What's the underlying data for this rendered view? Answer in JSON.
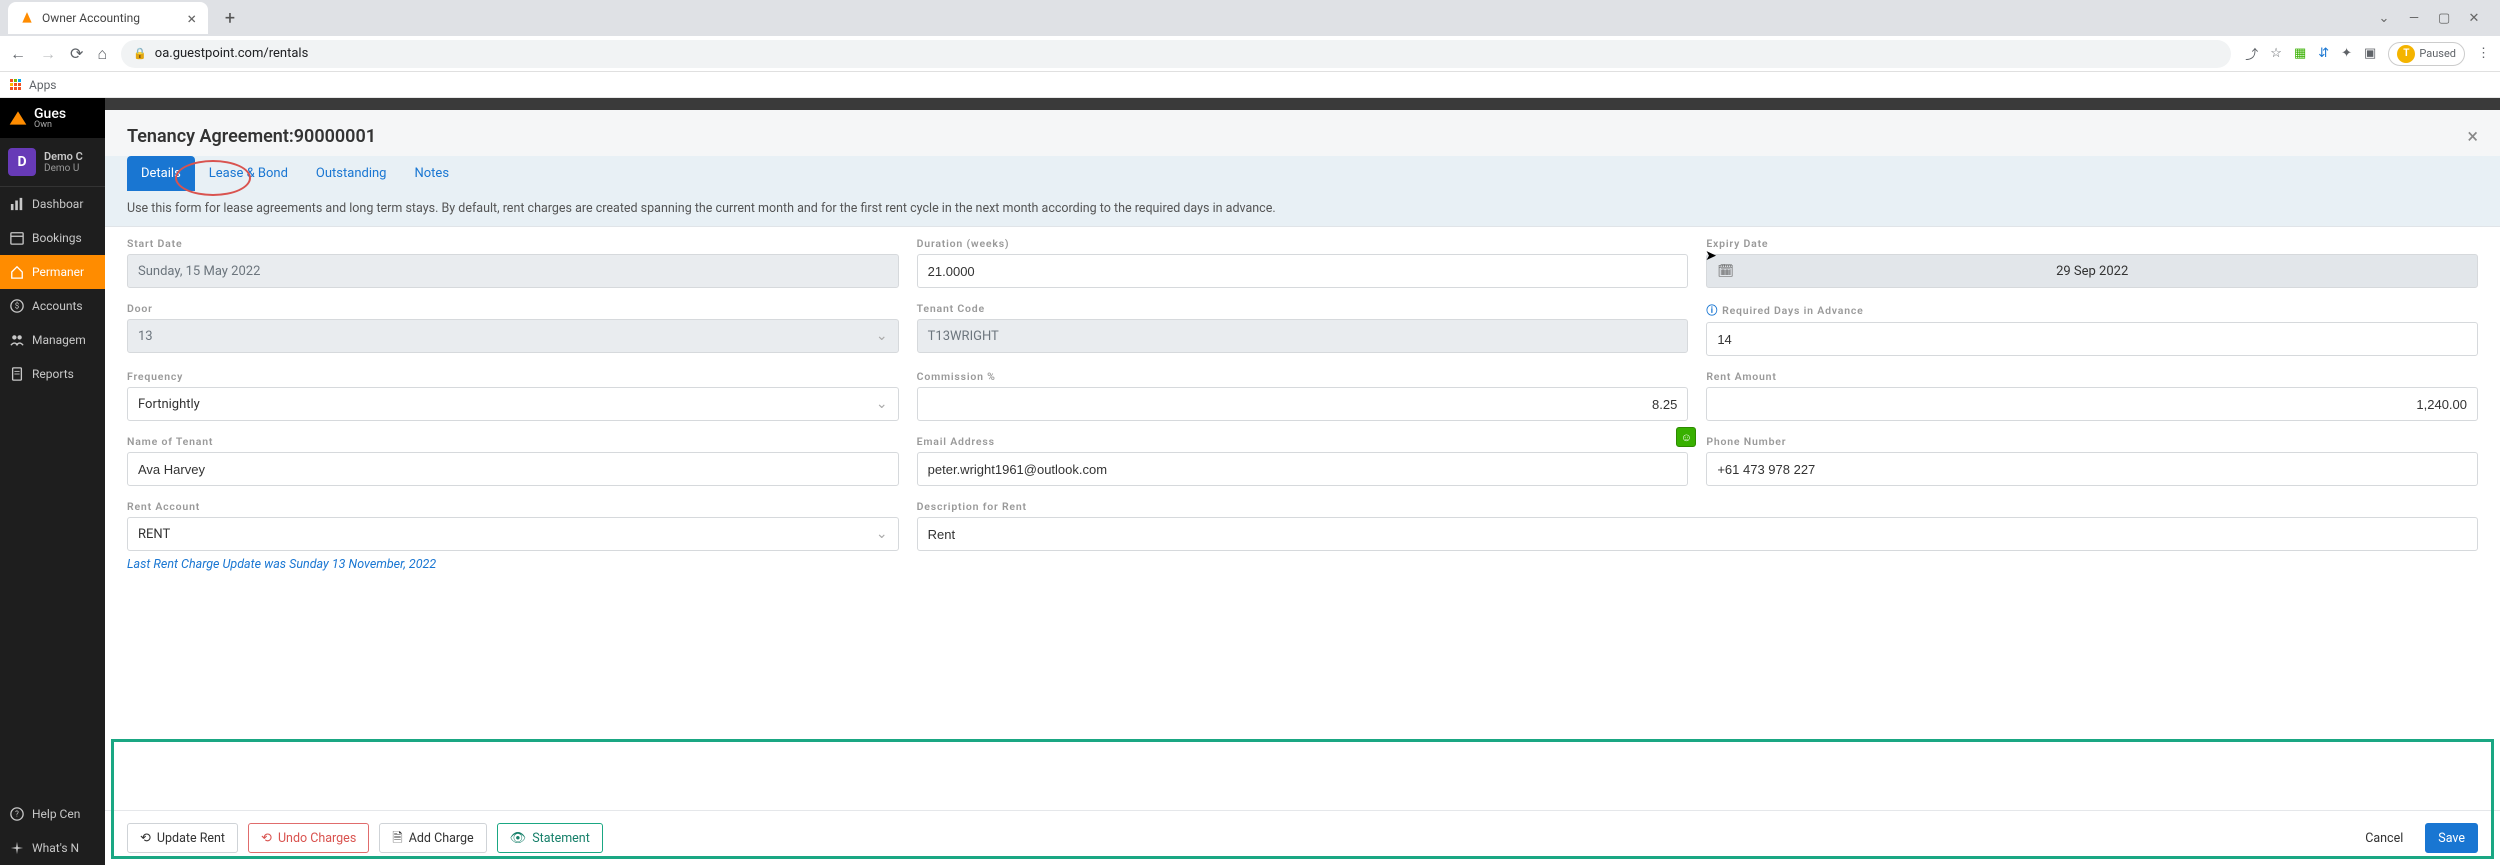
{
  "browser": {
    "tab_title": "Owner Accounting",
    "url_display": "oa.guestpoint.com/rentals",
    "bookmarks_apps": "Apps",
    "paused_label": "Paused",
    "paused_initial": "T"
  },
  "sidebar": {
    "brand": "Gues",
    "brand_sub": "Own",
    "profile_initial": "D",
    "profile_name": "Demo C",
    "profile_org": "Demo U",
    "items": [
      {
        "label": "Dashboar"
      },
      {
        "label": "Bookings"
      },
      {
        "label": "Permaner"
      },
      {
        "label": "Accounts"
      },
      {
        "label": "Managem"
      },
      {
        "label": "Reports"
      }
    ],
    "bottom_items": [
      {
        "label": "Help Cen"
      },
      {
        "label": "What's N"
      }
    ]
  },
  "panel": {
    "title": "Tenancy Agreement:90000001",
    "tabs": [
      {
        "label": "Details",
        "active": true
      },
      {
        "label": "Lease & Bond"
      },
      {
        "label": "Outstanding"
      },
      {
        "label": "Notes"
      }
    ],
    "hint": "Use this form for lease agreements and long term stays. By default, rent charges are created spanning the current month and for the first rent cycle in the next month according to the required days in advance."
  },
  "form": {
    "start_date_label": "Start Date",
    "start_date": "Sunday, 15 May 2022",
    "duration_label": "Duration (weeks)",
    "duration": "21.0000",
    "expiry_label": "Expiry Date",
    "expiry": "29 Sep 2022",
    "door_label": "Door",
    "door": "13",
    "tenant_code_label": "Tenant Code",
    "tenant_code": "T13WRIGHT",
    "req_days_label": "Required Days in Advance",
    "req_days": "14",
    "frequency_label": "Frequency",
    "frequency": "Fortnightly",
    "commission_label": "Commission %",
    "commission": "8.25",
    "rent_amount_label": "Rent Amount",
    "rent_amount": "1,240.00",
    "name_label": "Name of Tenant",
    "name": "Ava Harvey",
    "email_label": "Email Address",
    "email": "peter.wright1961@outlook.com",
    "phone_label": "Phone Number",
    "phone": "+61 473 978 227",
    "rent_account_label": "Rent Account",
    "rent_account": "RENT",
    "desc_label": "Description for Rent",
    "desc": "Rent",
    "last_update": "Last Rent Charge Update was Sunday 13 November, 2022"
  },
  "footer": {
    "update_rent": "Update Rent",
    "undo_charges": "Undo Charges",
    "add_charge": "Add Charge",
    "statement": "Statement",
    "cancel": "Cancel",
    "save": "Save"
  }
}
